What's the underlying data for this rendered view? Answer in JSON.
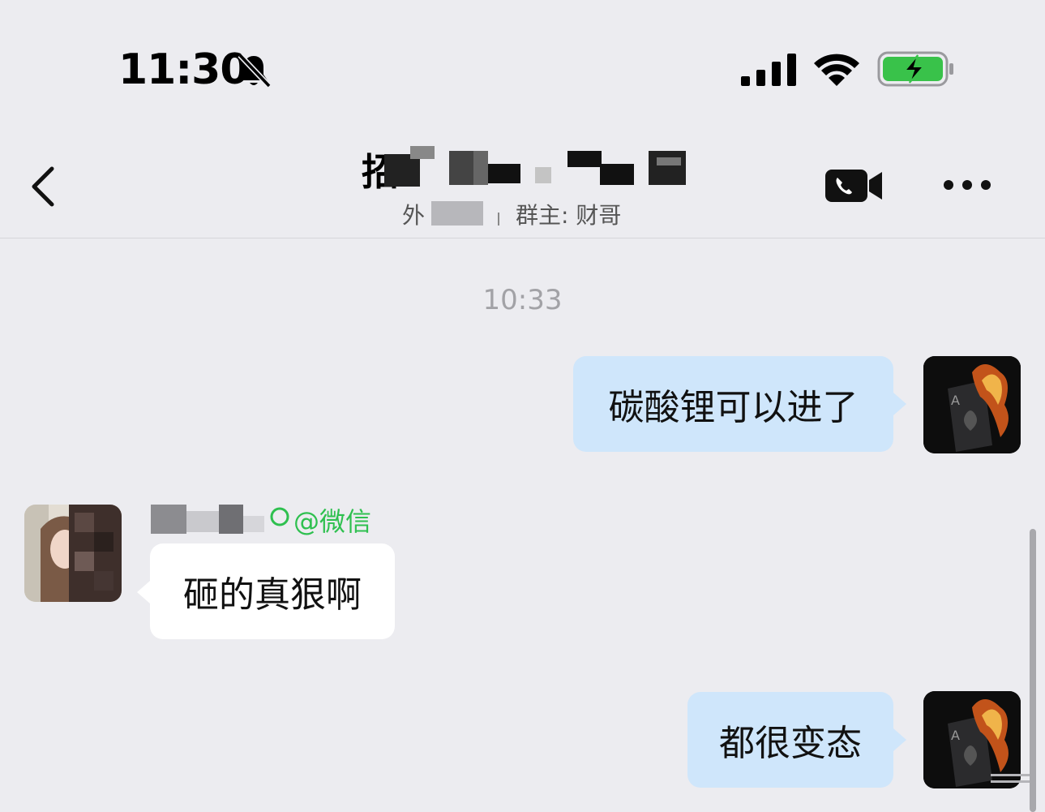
{
  "status_bar": {
    "time": "11:30",
    "icons": [
      "bell-slash-icon",
      "cellular-signal-icon",
      "wifi-icon",
      "battery-charging-icon"
    ],
    "battery_color": "#39c24a"
  },
  "header": {
    "title": "招",
    "subtitle_prefix": "外",
    "subtitle_owner": "群主: 财哥",
    "video_icon": "video-call-icon",
    "more_icon": "more-icon"
  },
  "chat": {
    "timestamp": "10:33",
    "messages": [
      {
        "direction": "out",
        "text": "碳酸锂可以进了"
      },
      {
        "direction": "in",
        "sender_source": "@微信",
        "text": "砸的真狠啊"
      },
      {
        "direction": "out",
        "text": "都很变态"
      }
    ]
  },
  "colors": {
    "background": "#ececf0",
    "outgoing_bubble": "#cfe6fb",
    "incoming_bubble": "#ffffff",
    "source_green": "#2ec04f"
  }
}
